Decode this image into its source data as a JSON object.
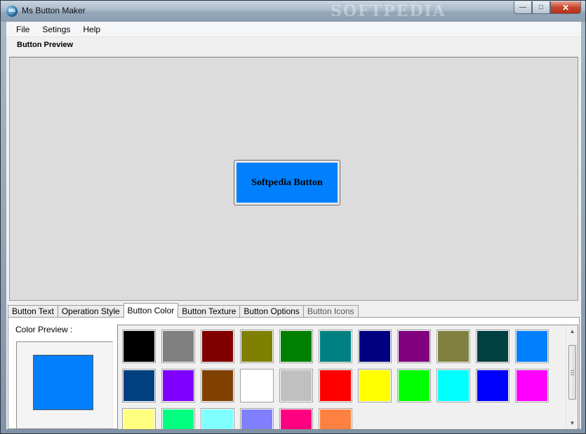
{
  "window": {
    "title": "Ms Button Maker",
    "icon_text": "MB",
    "watermark": "SOFTPEDIA",
    "controls": {
      "minimize": "—",
      "maximize": "□",
      "close": "✕"
    }
  },
  "menu": {
    "items": [
      {
        "label": "File"
      },
      {
        "label": "Setings"
      },
      {
        "label": "Help"
      }
    ]
  },
  "preview": {
    "section_label": "Button Preview",
    "button_text": "Softpedia Button",
    "button_color": "#0080ff"
  },
  "tabs": [
    {
      "label": "Button Text",
      "active": false
    },
    {
      "label": "Operation Style",
      "active": false
    },
    {
      "label": "Button Color",
      "active": true
    },
    {
      "label": "Button Texture",
      "active": false
    },
    {
      "label": "Button Options",
      "active": false
    },
    {
      "label": "Button Icons",
      "active": false
    }
  ],
  "color_panel": {
    "preview_label": "Color Preview :",
    "preview_color": "#0080ff",
    "palette": [
      "#000000",
      "#808080",
      "#800000",
      "#808000",
      "#008000",
      "#008080",
      "#000080",
      "#800080",
      "#808040",
      "#004040",
      "#0080ff",
      "#004080",
      "#8000ff",
      "#804000",
      "#ffffff",
      "#c0c0c0",
      "#ff0000",
      "#ffff00",
      "#00ff00",
      "#00ffff",
      "#0000ff",
      "#ff00ff",
      "#ffff80",
      "#00ff80",
      "#80ffff",
      "#8080ff",
      "#ff0080",
      "#ff8040"
    ]
  }
}
